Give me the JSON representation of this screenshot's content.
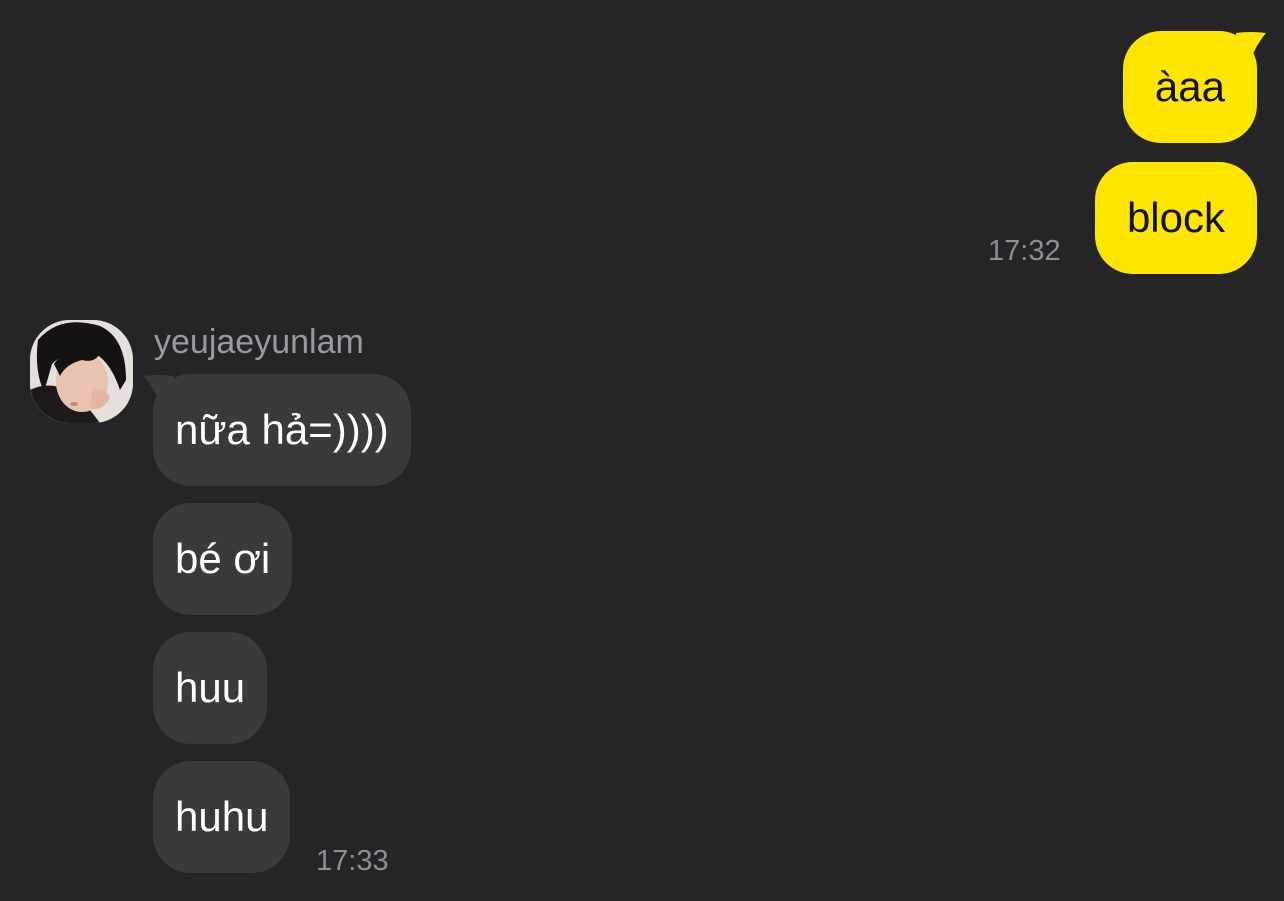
{
  "outgoing": {
    "messages": [
      {
        "text": "àaa"
      },
      {
        "text": "block",
        "time": "17:32"
      }
    ],
    "colors": {
      "bubble": "#fee500",
      "text": "#111111"
    }
  },
  "incoming": {
    "sender": "yeujaeyunlam",
    "avatar_icon": "profile-photo",
    "messages": [
      {
        "text": "nữa hả=))))"
      },
      {
        "text": "bé ơi"
      },
      {
        "text": "huu"
      },
      {
        "text": "huhu",
        "time": "17:33"
      }
    ],
    "colors": {
      "bubble": "#3a3a3c",
      "text": "#ffffff"
    }
  },
  "theme": {
    "background": "#252527",
    "timestamp_color": "#8e8e93"
  }
}
